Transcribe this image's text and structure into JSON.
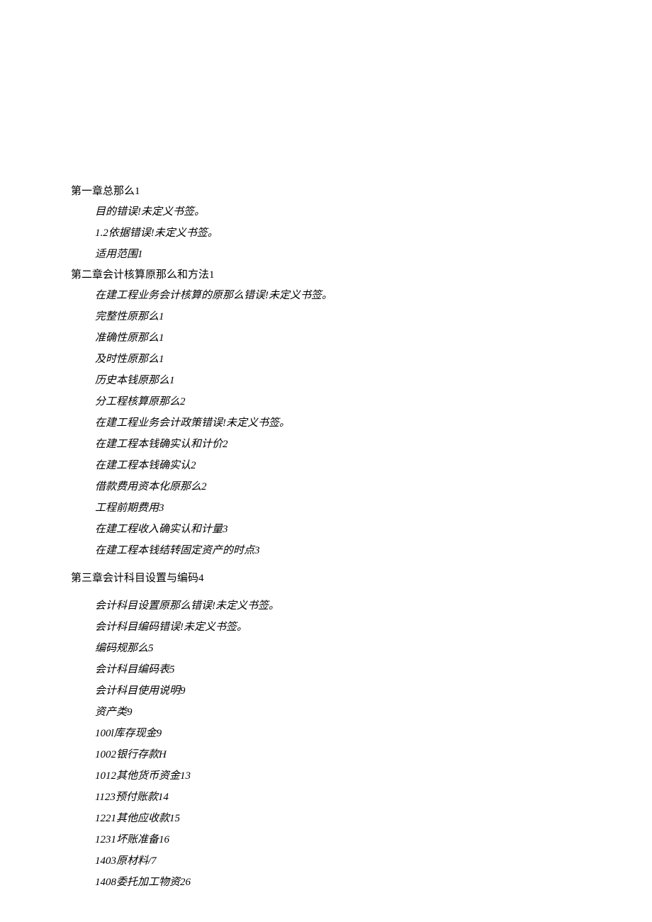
{
  "toc": {
    "chapter1": {
      "title": "第一章总那么1",
      "items": [
        "目的错误!未定义书签。",
        "1.2依据错误!未定义书签。",
        "适用范围1"
      ]
    },
    "chapter2": {
      "title": "第二章会计核算原那么和方法1",
      "items": [
        "在建工程业务会计核算的原那么错误!未定义书签。",
        "完整性原那么1",
        "准确性原那么1",
        "及时性原那么1",
        "历史本钱原那么1",
        "分工程核算原那么2",
        "在建工程业务会计政策错误!未定义书签。",
        "在建工程本钱确实认和计价2",
        "在建工程本钱确实认2",
        "借款费用资本化原那么2",
        "工程前期费用3",
        "在建工程收入确实认和计量3",
        "在建工程本钱结转固定资产的时点3"
      ]
    },
    "chapter3": {
      "title": "第三章会计科目设置与编码4",
      "items": [
        "会计科目设置原那么错误!未定义书签。",
        "会计科目编码错误!未定义书签。",
        "编码规那么5",
        "会计科目编码表5",
        "会计科目使用说明9",
        "资产类9",
        "100l库存现金9",
        "1002银行存款H",
        "1012其他货币资金13",
        "1123预付账款14",
        "1221其他应收款15",
        "1231坏账准备16",
        "1403原材料/7",
        "1408委托加工物资26"
      ]
    }
  }
}
